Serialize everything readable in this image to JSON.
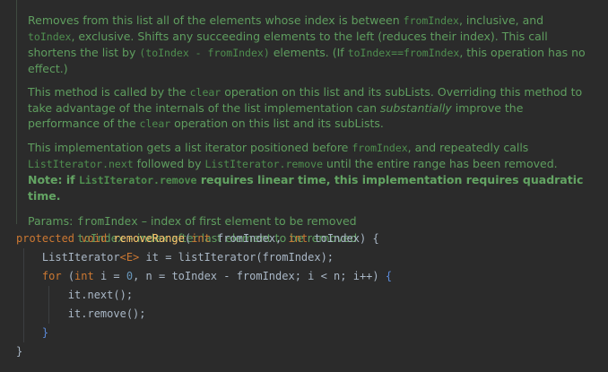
{
  "doc": {
    "p1": {
      "t1": "Removes from this list all of the elements whose index is between ",
      "c1": "fromIndex",
      "t2": ", inclusive, and ",
      "c2": "toIndex",
      "t3": ", exclusive. Shifts any succeeding elements to the left (reduces their index). This call shortens the list by ",
      "c3": "(toIndex - fromIndex)",
      "t4": " elements. (If ",
      "c4": "toIndex==fromIndex",
      "t5": ", this operation has no effect.)"
    },
    "p2": {
      "t1": "This method is called by the ",
      "c1": "clear",
      "t2": " operation on this list and its subLists. Overriding this method to take advantage of the internals of the list implementation can ",
      "em": "substantially",
      "t3": " improve the performance of the ",
      "c2": "clear",
      "t4": " operation on this list and its subLists."
    },
    "p3": {
      "t1": "This implementation gets a list iterator positioned before ",
      "c1": "fromIndex",
      "t2": ", and repeatedly calls ",
      "c2": "ListIterator.next",
      "t3": " followed by ",
      "c3": "ListIterator.remove",
      "t4": " until the entire range has been removed.",
      "b1": "Note: if ",
      "bc": "ListIterator.remove",
      "b2": " requires linear time, this implementation requires quadratic time."
    },
    "params_label": "Params:",
    "params": [
      {
        "name": "fromIndex",
        "desc": "– index of first element to be removed"
      },
      {
        "name": "toIndex",
        "desc": "– index after last element to be removed"
      }
    ]
  },
  "code": {
    "l1": {
      "k1": "protected",
      "k2": "void",
      "fn": "removeRange",
      "p1": "(",
      "k3": "int",
      "a1": " fromIndex, ",
      "k4": "int",
      "a2": " toIndex) {"
    },
    "l2": {
      "t1": "ListIterator",
      "g": "<E>",
      "t2": " it = listIterator(fromIndex);"
    },
    "l3": {
      "k1": "for",
      "t1": " (",
      "k2": "int",
      "t2": " i = ",
      "n": "0",
      "t3": ", n = toIndex - fromIndex; i < n; i++) ",
      "b": "{"
    },
    "l4": "it.next();",
    "l5": "it.remove();",
    "l6": "}",
    "l7": "}"
  }
}
